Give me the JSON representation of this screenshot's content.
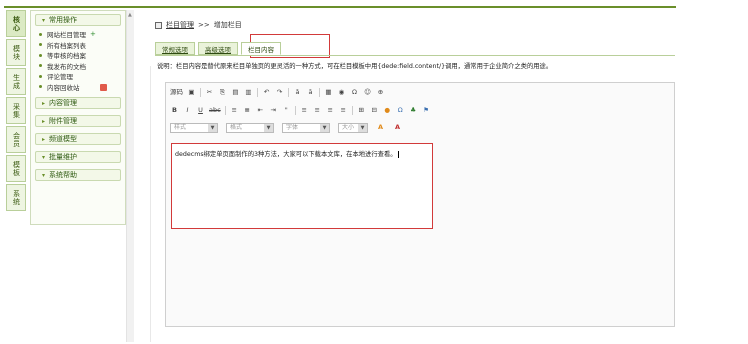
{
  "vertical_tabs": [
    {
      "label": "核心",
      "active": true
    },
    {
      "label": "模块"
    },
    {
      "label": "生成"
    },
    {
      "label": "采集"
    },
    {
      "label": "会员"
    },
    {
      "label": "模板"
    },
    {
      "label": "系统"
    }
  ],
  "menu": {
    "group_common": "常用操作",
    "items": [
      {
        "label": "网站栏目管理",
        "plus": "+"
      },
      {
        "label": "所有档案列表"
      },
      {
        "label": "等审核的档案"
      },
      {
        "label": "我发布的文档"
      },
      {
        "label": "评论管理"
      },
      {
        "label": "内容回收站",
        "badge": true
      }
    ],
    "groups": [
      {
        "label": "内容管理",
        "arrow": "▸"
      },
      {
        "label": "附件管理",
        "arrow": "▸"
      },
      {
        "label": "频道模型",
        "arrow": "▸"
      },
      {
        "label": "批量维护",
        "arrow": "▾"
      },
      {
        "label": "系统帮助",
        "arrow": "▾"
      }
    ]
  },
  "breadcrumb": {
    "part1": "栏目管理",
    "sep": ">>",
    "part2": "增加栏目"
  },
  "tabs": [
    {
      "label": "常规选项"
    },
    {
      "label": "高级选项"
    },
    {
      "label": "栏目内容",
      "active": true
    }
  ],
  "description": "说明：栏目内容是替代原来栏目单独页的更灵活的一种方式，可在栏目模板中用{dede:field.content/}调用，通常用于企业简介之类的用途。",
  "editor": {
    "toolbar_row1": [
      "源码",
      "▣",
      "✂",
      "⎘",
      "▤",
      "▥",
      "↶",
      "↷",
      "ǎ",
      "ā",
      "▦",
      "◉",
      "Ω",
      "☺",
      "⊕"
    ],
    "toolbar_row2": [
      "B",
      "I",
      "U",
      "abc",
      "≡",
      "≣",
      "⇤",
      "⇥",
      "\"",
      "≡",
      "≡",
      "≡",
      "≡",
      "⊞",
      "⊟",
      "●",
      "Ω",
      "♣",
      "⚑"
    ],
    "combos": [
      "样式",
      "格式",
      "字体",
      "大小"
    ],
    "content": "dedecms绑定单页面制作的3种方法，大家可以下载本文库，在本地进行查看。"
  }
}
